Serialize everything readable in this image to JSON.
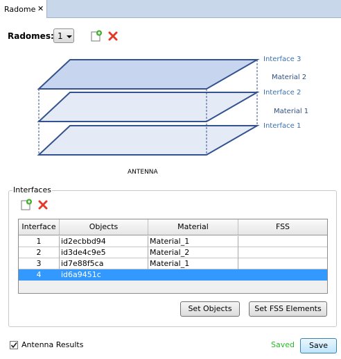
{
  "tab": {
    "label": "Radome",
    "close": "✕"
  },
  "radomes": {
    "label": "Radomes:",
    "selected": "1"
  },
  "diagram": {
    "interface_labels": [
      "Interface 3",
      "Interface 2",
      "Interface 1"
    ],
    "material_labels": [
      "Material 2",
      "Material 1"
    ],
    "antenna_label": "ANTENNA",
    "colors": {
      "label": "#3a6fb0",
      "plate_top": "#c7d6ee",
      "plate": "#e4ebf7",
      "edge": "#33528f"
    }
  },
  "interfaces": {
    "title": "Interfaces",
    "columns": [
      "Interface",
      "Objects",
      "Material",
      "FSS"
    ],
    "rows": [
      {
        "interface": "1",
        "objects": "id2ecbbd94",
        "material": "Material_1",
        "fss": ""
      },
      {
        "interface": "2",
        "objects": "id3de4c9e5",
        "material": "Material_2",
        "fss": ""
      },
      {
        "interface": "3",
        "objects": "id7e88f5ca",
        "material": "Material_1",
        "fss": ""
      },
      {
        "interface": "4",
        "objects": "id6a9451c",
        "material": "",
        "fss": ""
      }
    ],
    "selected_row": 3,
    "set_objects_label": "Set Objects",
    "set_fss_label": "Set FSS Elements"
  },
  "footer": {
    "antenna_results_label": "Antenna Results",
    "antenna_results_checked": true,
    "status": "Saved",
    "status_color": "#2bb52b",
    "save_label": "Save"
  }
}
